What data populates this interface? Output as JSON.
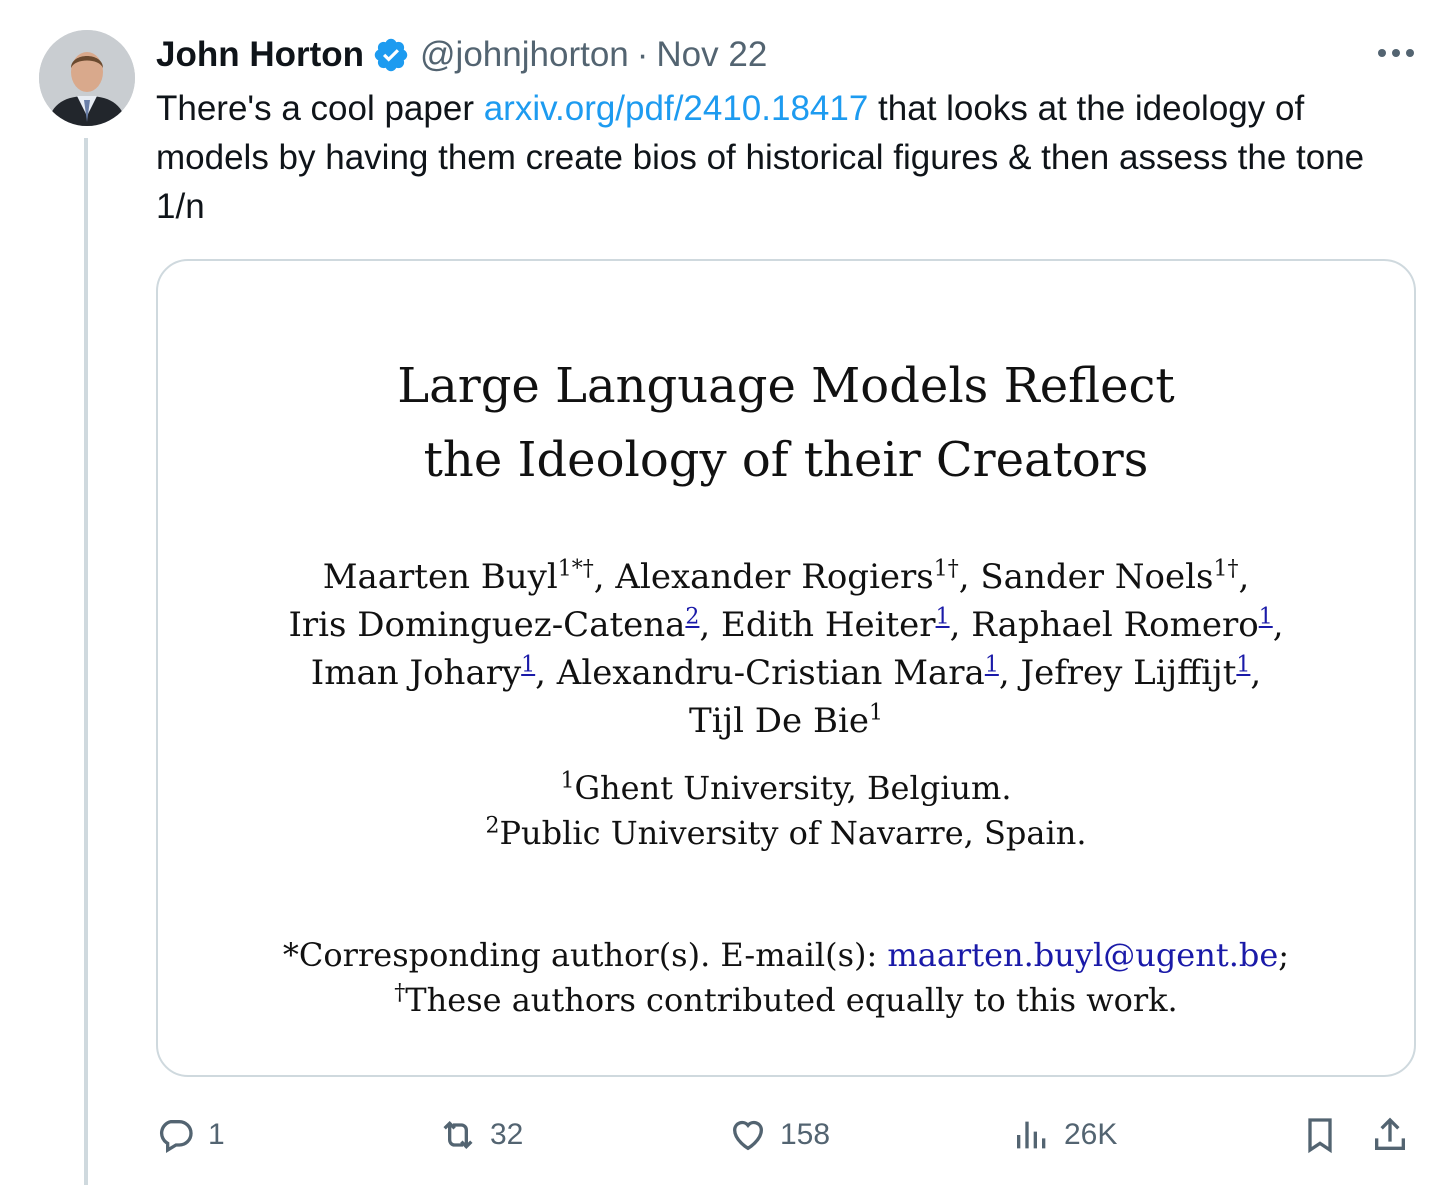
{
  "tweet": {
    "author_name": "John Horton",
    "handle": "@johnjhorton",
    "separator": "·",
    "date": "Nov 22",
    "text_before": "There's a cool paper ",
    "link": "arxiv.org/pdf/2410.18417",
    "text_after": " that looks at the ideology of models by having them create bios of historical figures & then assess the tone 1/n"
  },
  "paper": {
    "title_line1": "Large Language Models Reflect",
    "title_line2": "the Ideology of their Creators",
    "author_lines": [
      [
        {
          "name": "Maarten Buyl",
          "sup": "1*†",
          "sep": ", "
        },
        {
          "name": "Alexander Rogiers",
          "sup": "1†",
          "sep": ", "
        },
        {
          "name": "Sander Noels",
          "sup": "1†",
          "sep": ","
        }
      ],
      [
        {
          "name": "Iris Dominguez-Catena",
          "sup": "2",
          "linked": true,
          "sep": ", "
        },
        {
          "name": "Edith Heiter",
          "sup": "1",
          "linked": true,
          "sep": ", "
        },
        {
          "name": "Raphael Romero",
          "sup": "1",
          "linked": true,
          "sep": ","
        }
      ],
      [
        {
          "name": "Iman Johary",
          "sup": "1",
          "linked": true,
          "sep": ", "
        },
        {
          "name": "Alexandru-Cristian Mara",
          "sup": "1",
          "linked": true,
          "sep": ", "
        },
        {
          "name": "Jefrey Lijffijt",
          "sup": "1",
          "linked": true,
          "sep": ","
        }
      ],
      [
        {
          "name": "Tijl De Bie",
          "sup": "1",
          "sep": ""
        }
      ]
    ],
    "affiliation1_mark": "1",
    "affiliation1": "Ghent University, Belgium.",
    "affiliation2_mark": "2",
    "affiliation2": "Public University of Navarre, Spain.",
    "corresponding_prefix": "*Corresponding author(s). E-mail(s): ",
    "corresponding_email": "maarten.buyl@ugent.be",
    "corresponding_suffix": ";",
    "equal_mark": "†",
    "equal_note": "These authors contributed equally to this work."
  },
  "actions": {
    "reply_count": "1",
    "retweet_count": "32",
    "like_count": "158",
    "views_count": "26K"
  },
  "icons": {
    "avatar": "avatar-photo",
    "verified": "verified-badge-icon",
    "more": "more-icon",
    "reply": "reply-icon",
    "retweet": "retweet-icon",
    "like": "heart-icon",
    "views": "views-icon",
    "bookmark": "bookmark-icon",
    "share": "share-icon"
  },
  "colors": {
    "link": "#1d9bf0",
    "secondary_text": "#536471",
    "border": "#cfd9de",
    "paper_link": "#1a1aa8"
  }
}
